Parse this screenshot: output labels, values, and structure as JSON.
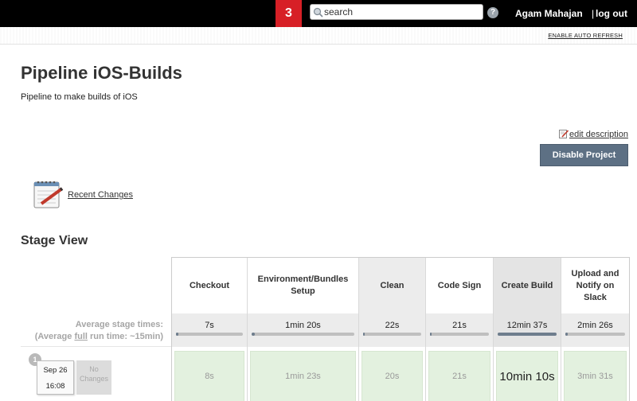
{
  "header": {
    "badge_count": "3",
    "search_placeholder": "search",
    "help_symbol": "?",
    "username": "Agam Mahajan",
    "separator": "|",
    "logout_label": "log out",
    "auto_refresh_label": "ENABLE AUTO REFRESH"
  },
  "page": {
    "title": "Pipeline iOS-Builds",
    "description": "Pipeline to make builds of iOS",
    "edit_description_label": "edit description",
    "disable_button_label": "Disable Project",
    "recent_changes_label": "Recent Changes"
  },
  "stage_view": {
    "title": "Stage View",
    "avg_stage_times_label": "Average stage times:",
    "avg_run_time_prefix": "(Average ",
    "avg_run_time_full": "full",
    "avg_run_time_suffix": " run time: ~15min)",
    "stages": [
      {
        "name": "Checkout",
        "avg": "7s",
        "avg_fraction": 0.01,
        "run_time": "8s"
      },
      {
        "name": "Environment/Bundles Setup",
        "avg": "1min 20s",
        "avg_fraction": 0.02,
        "run_time": "1min 23s"
      },
      {
        "name": "Clean",
        "avg": "22s",
        "avg_fraction": 0.01,
        "run_time": "20s"
      },
      {
        "name": "Code Sign",
        "avg": "21s",
        "avg_fraction": 0.01,
        "run_time": "21s"
      },
      {
        "name": "Create Build",
        "avg": "12min 37s",
        "avg_fraction": 1.0,
        "run_time": "10min 10s"
      },
      {
        "name": "Upload and Notify on Slack",
        "avg": "2min 26s",
        "avg_fraction": 0.04,
        "run_time": "3min 31s"
      }
    ],
    "run": {
      "number": "1",
      "date": "Sep 26",
      "time": "16:08",
      "changes_label": "No Changes"
    }
  },
  "icons": {
    "search": "search-icon",
    "help": "help-icon",
    "edit": "edit-icon",
    "notepad": "notepad-icon"
  }
}
